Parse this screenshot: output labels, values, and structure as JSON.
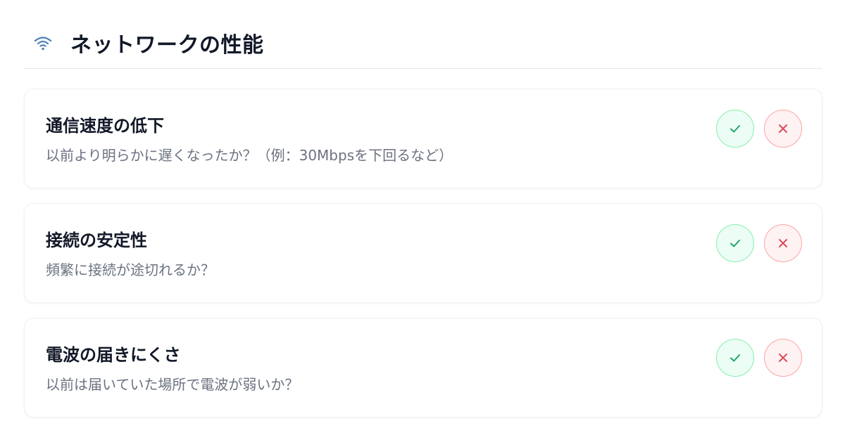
{
  "header": {
    "title": "ネットワークの性能",
    "icon": "wifi-icon"
  },
  "colors": {
    "accent": "#4a7fb8",
    "yes": "#22a565",
    "no": "#dc4a5c"
  },
  "items": [
    {
      "title": "通信速度の低下",
      "description": "以前より明らかに遅くなったか？（例：30Mbpsを下回るなど）",
      "yes_icon": "check-icon",
      "no_icon": "close-icon"
    },
    {
      "title": "接続の安定性",
      "description": "頻繁に接続が途切れるか？",
      "yes_icon": "check-icon",
      "no_icon": "close-icon"
    },
    {
      "title": "電波の届きにくさ",
      "description": "以前は届いていた場所で電波が弱いか？",
      "yes_icon": "check-icon",
      "no_icon": "close-icon"
    }
  ]
}
